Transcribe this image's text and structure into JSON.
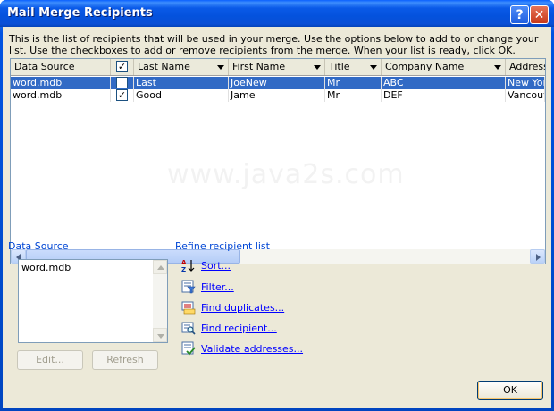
{
  "window": {
    "title": "Mail Merge Recipients",
    "help_label": "?",
    "close_label": "✕"
  },
  "intro_text": "This is the list of recipients that will be used in your merge.  Use the options below to add to or change your list.  Use the checkboxes to add or remove recipients from the merge.  When your list is ready, click OK.",
  "grid": {
    "columns": [
      "Data Source",
      "",
      "Last Name",
      "First Name",
      "Title",
      "Company Name",
      "Address"
    ],
    "header_checked": "✓",
    "rows": [
      {
        "source": "word.mdb",
        "checked": "",
        "last": "Last",
        "first": "JoeNew",
        "title": "Mr",
        "company": "ABC",
        "address": "New Yor"
      },
      {
        "source": "word.mdb",
        "checked": "✓",
        "last": "Good",
        "first": "Jame",
        "title": "Mr",
        "company": "DEF",
        "address": "Vancouv"
      }
    ],
    "watermark": "www.java2s.com"
  },
  "data_source": {
    "label": "Data Source",
    "items": [
      "word.mdb"
    ],
    "edit_button": "Edit...",
    "refresh_button": "Refresh"
  },
  "refine": {
    "label": "Refine recipient list",
    "links": [
      {
        "label": "Sort...",
        "icon": "sort-icon"
      },
      {
        "label": "Filter...",
        "icon": "filter-icon"
      },
      {
        "label": "Find duplicates...",
        "icon": "find-duplicates-icon"
      },
      {
        "label": "Find recipient...",
        "icon": "find-recipient-icon"
      },
      {
        "label": "Validate addresses...",
        "icon": "validate-addresses-icon"
      }
    ]
  },
  "ok_button": "OK",
  "colors": {
    "selection": "#316ac5",
    "link": "#0000ff",
    "section_label": "#0046d5"
  }
}
